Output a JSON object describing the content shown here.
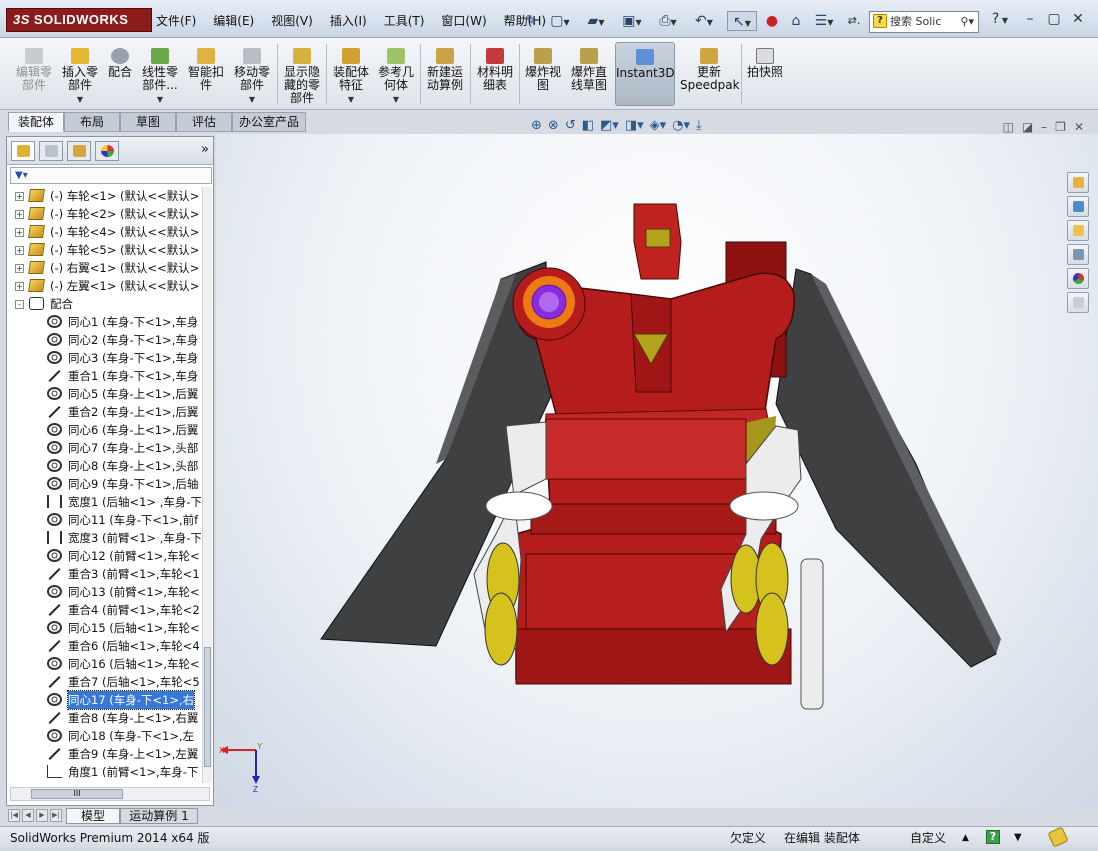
{
  "app": {
    "logo_text": "SOLIDWORKS",
    "logo_prefix": "3S"
  },
  "menu": [
    "文件(F)",
    "编辑(E)",
    "视图(V)",
    "插入(I)",
    "工具(T)",
    "窗口(W)",
    "帮助(H)"
  ],
  "search": {
    "placeholder": "搜索 Solic"
  },
  "commands": [
    {
      "label": "编辑零\n部件",
      "state": "disabled"
    },
    {
      "label": "插入零\n部件",
      "state": "normal"
    },
    {
      "label": "配合",
      "state": "normal"
    },
    {
      "label": "线性零\n部件...",
      "state": "normal"
    },
    {
      "label": "智能扣\n件",
      "state": "normal"
    },
    {
      "label": "移动零\n部件",
      "state": "normal"
    },
    {
      "label": "显示隐\n藏的零\n部件",
      "state": "normal"
    },
    {
      "label": "装配体\n特征",
      "state": "normal"
    },
    {
      "label": "参考几\n何体",
      "state": "normal"
    },
    {
      "label": "新建运\n动算例",
      "state": "normal"
    },
    {
      "label": "材料明\n细表",
      "state": "normal"
    },
    {
      "label": "爆炸视\n图",
      "state": "normal"
    },
    {
      "label": "爆炸直\n线草图",
      "state": "normal"
    },
    {
      "label": "Instant3D",
      "state": "active"
    },
    {
      "label": "更新\nSpeedpak",
      "state": "normal"
    },
    {
      "label": "拍快照",
      "state": "normal"
    }
  ],
  "main_tabs": [
    {
      "label": "装配体",
      "selected": true
    },
    {
      "label": "布局",
      "selected": false
    },
    {
      "label": "草图",
      "selected": false
    },
    {
      "label": "评估",
      "selected": false
    },
    {
      "label": "办公室产品",
      "selected": false
    }
  ],
  "tree": {
    "items": [
      {
        "text": "(-) 车轮<1> (默认<<默认>",
        "type": "component",
        "expander": "+",
        "indent": 0
      },
      {
        "text": "(-) 车轮<2> (默认<<默认>",
        "type": "component",
        "expander": "+",
        "indent": 0
      },
      {
        "text": "(-) 车轮<4> (默认<<默认>",
        "type": "component",
        "expander": "+",
        "indent": 0
      },
      {
        "text": "(-) 车轮<5> (默认<<默认>",
        "type": "component",
        "expander": "+",
        "indent": 0
      },
      {
        "text": "(-) 右翼<1> (默认<<默认>",
        "type": "component",
        "expander": "+",
        "indent": 0
      },
      {
        "text": "(-) 左翼<1> (默认<<默认>",
        "type": "component",
        "expander": "+",
        "indent": 0
      },
      {
        "text": "配合",
        "type": "mates",
        "expander": "-",
        "indent": 0
      },
      {
        "text": "同心1 (车身-下<1>,车身",
        "type": "concentric",
        "indent": 1
      },
      {
        "text": "同心2 (车身-下<1>,车身",
        "type": "concentric",
        "indent": 1
      },
      {
        "text": "同心3 (车身-下<1>,车身",
        "type": "concentric",
        "indent": 1
      },
      {
        "text": "重合1 (车身-下<1>,车身",
        "type": "coincident",
        "indent": 1
      },
      {
        "text": "同心5 (车身-上<1>,后翼",
        "type": "concentric",
        "indent": 1
      },
      {
        "text": "重合2 (车身-上<1>,后翼",
        "type": "coincident",
        "indent": 1
      },
      {
        "text": "同心6 (车身-上<1>,后翼",
        "type": "concentric",
        "indent": 1
      },
      {
        "text": "同心7 (车身-上<1>,头部",
        "type": "concentric",
        "indent": 1
      },
      {
        "text": "同心8 (车身-上<1>,头部",
        "type": "concentric",
        "indent": 1
      },
      {
        "text": "同心9 (车身-下<1>,后轴",
        "type": "concentric",
        "indent": 1
      },
      {
        "text": "宽度1 (后轴<1> ,车身-下",
        "type": "width",
        "indent": 1
      },
      {
        "text": "同心11 (车身-下<1>,前f",
        "type": "concentric",
        "indent": 1
      },
      {
        "text": "宽度3 (前臂<1> ,车身-下",
        "type": "width",
        "indent": 1
      },
      {
        "text": "同心12 (前臂<1>,车轮<",
        "type": "concentric",
        "indent": 1
      },
      {
        "text": "重合3 (前臂<1>,车轮<1",
        "type": "coincident",
        "indent": 1
      },
      {
        "text": "同心13 (前臂<1>,车轮<",
        "type": "concentric",
        "indent": 1
      },
      {
        "text": "重合4 (前臂<1>,车轮<2",
        "type": "coincident",
        "indent": 1
      },
      {
        "text": "同心15 (后轴<1>,车轮<",
        "type": "concentric",
        "indent": 1
      },
      {
        "text": "重合6 (后轴<1>,车轮<4",
        "type": "coincident",
        "indent": 1
      },
      {
        "text": "同心16 (后轴<1>,车轮<",
        "type": "concentric",
        "indent": 1
      },
      {
        "text": "重合7 (后轴<1>,车轮<5",
        "type": "coincident",
        "indent": 1
      },
      {
        "text": "同心17 (车身-下<1>,右",
        "type": "concentric",
        "indent": 1,
        "selected": true
      },
      {
        "text": "重合8 (车身-上<1>,右翼",
        "type": "coincident",
        "indent": 1
      },
      {
        "text": "同心18 (车身-下<1>,左",
        "type": "concentric",
        "indent": 1
      },
      {
        "text": "重合9 (车身-上<1>,左翼",
        "type": "coincident",
        "indent": 1
      },
      {
        "text": "角度1 (前臂<1>,车身-下",
        "type": "angle",
        "indent": 1
      }
    ]
  },
  "bottom_tabs": [
    {
      "label": "模型",
      "selected": true
    },
    {
      "label": "运动算例 1",
      "selected": false
    }
  ],
  "triad": {
    "x_label": "X",
    "y_label": "Y",
    "z_label": "Z"
  },
  "status": {
    "product": "SolidWorks Premium 2014 x64 版",
    "definition": "欠定义",
    "editing": "在编辑 装配体",
    "units": "自定义"
  },
  "colors": {
    "body_red": "#b51c1c",
    "body_dark": "#6e0c0c",
    "wing_gray": "#404244",
    "white_part": "#ececec",
    "wheel_yellow": "#d6c21c",
    "selection_blue": "#3778d6",
    "marker_orange": "#ee7a12",
    "marker_purple": "#8a2be2"
  }
}
